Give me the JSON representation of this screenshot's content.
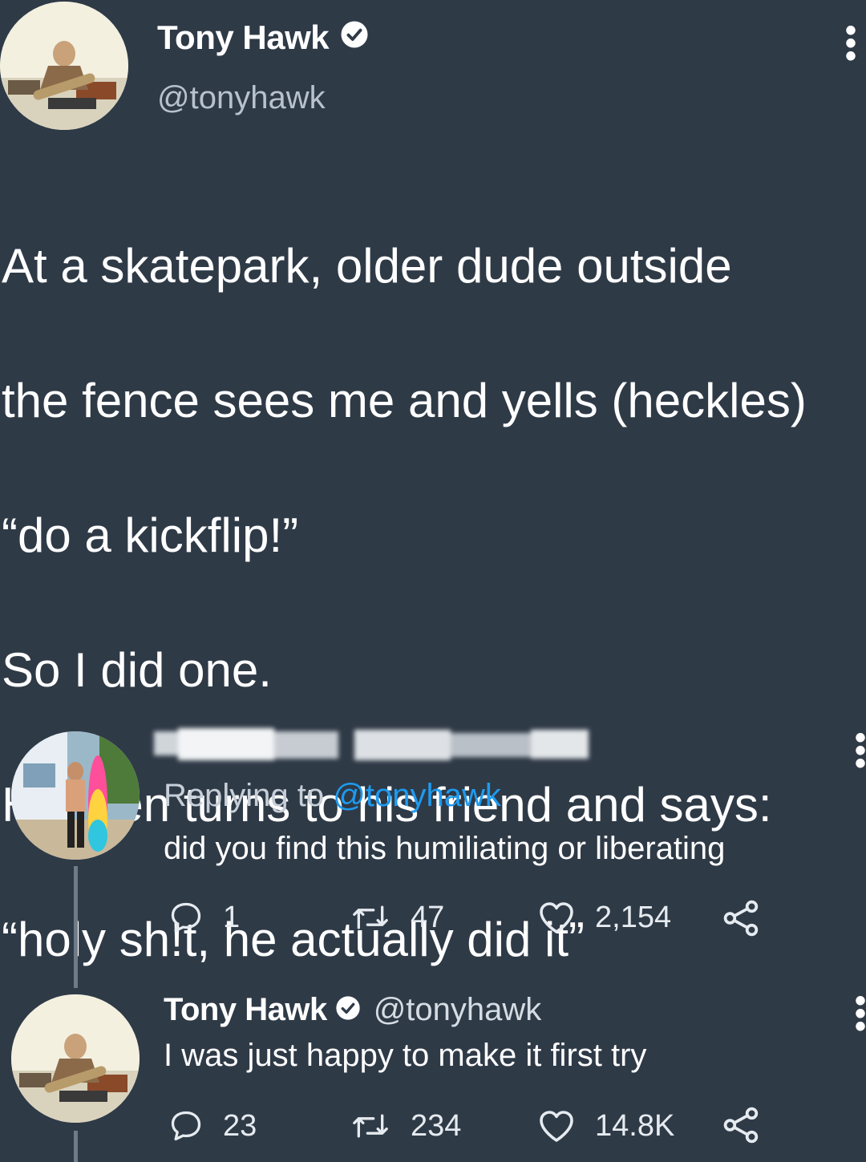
{
  "main_tweet": {
    "display_name": "Tony Hawk",
    "handle": "@tonyhawk",
    "text_lines": [
      "At a skatepark, older dude outside",
      "the fence sees me and yells (heckles)",
      "“do a kickflip!”",
      "So I did one.",
      "He then turns to his friend and says:",
      "“holy sh!t, he actually did it”"
    ],
    "more_icon": "vertical-ellipsis-icon"
  },
  "reply_tweet": {
    "display_name": "",
    "replying_prefix": "Replying to",
    "replying_handle": "@tonyhawk",
    "text": "did you find this humiliating or liberating",
    "actions": {
      "reply_count": "1",
      "retweet_count": "47",
      "like_count": "2,154"
    }
  },
  "tony_reply": {
    "display_name": "Tony Hawk",
    "handle": "@tonyhawk",
    "text": "I was just happy to make it first try",
    "actions": {
      "reply_count": "23",
      "retweet_count": "234",
      "like_count": "14.8K"
    }
  },
  "icons": {
    "reply": "comment-icon",
    "retweet": "retweet-icon",
    "like": "heart-icon",
    "share": "share-icon",
    "verified": "verified-badge-icon"
  },
  "colors": {
    "background": "#2f3a47",
    "mention": "#1d9bf0",
    "muted": "#b8c2cc"
  }
}
